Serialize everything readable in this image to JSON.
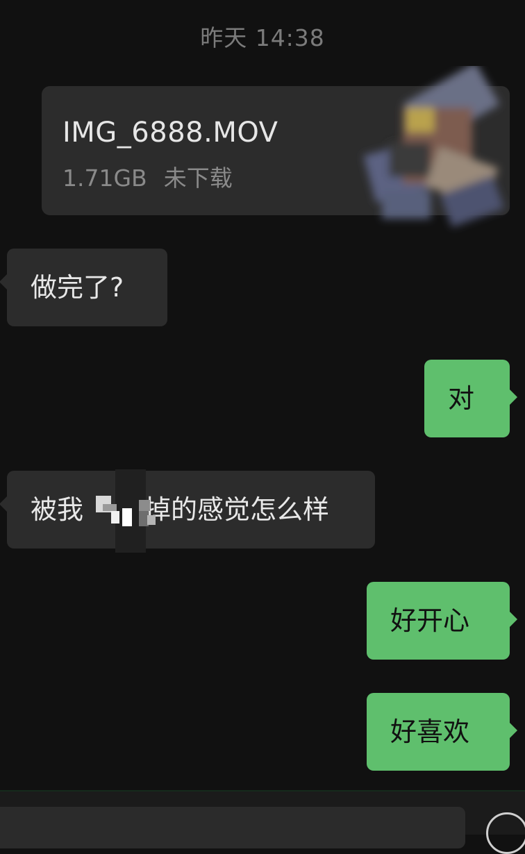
{
  "chat": {
    "timestamp": "昨天 14:38",
    "file_message": {
      "file_name": "IMG_6888.MOV",
      "file_size": "1.71GB",
      "download_status": "未下载",
      "thumbnail_icon": "video-thumbnail-blurred"
    },
    "messages": [
      {
        "side": "left",
        "text": "做完了?"
      },
      {
        "side": "right",
        "text": "对"
      },
      {
        "side": "left",
        "text_before": "被我",
        "text_after": "掉的感觉怎么样"
      },
      {
        "side": "right",
        "text": "好开心"
      },
      {
        "side": "right",
        "text": "好喜欢"
      }
    ]
  },
  "input_bar": {
    "icon": "plus-icon"
  },
  "colors": {
    "background": "#111111",
    "incoming_bubble": "#2c2c2c",
    "outgoing_bubble": "#5fbf6d",
    "timestamp_text": "#7b7b7b"
  }
}
